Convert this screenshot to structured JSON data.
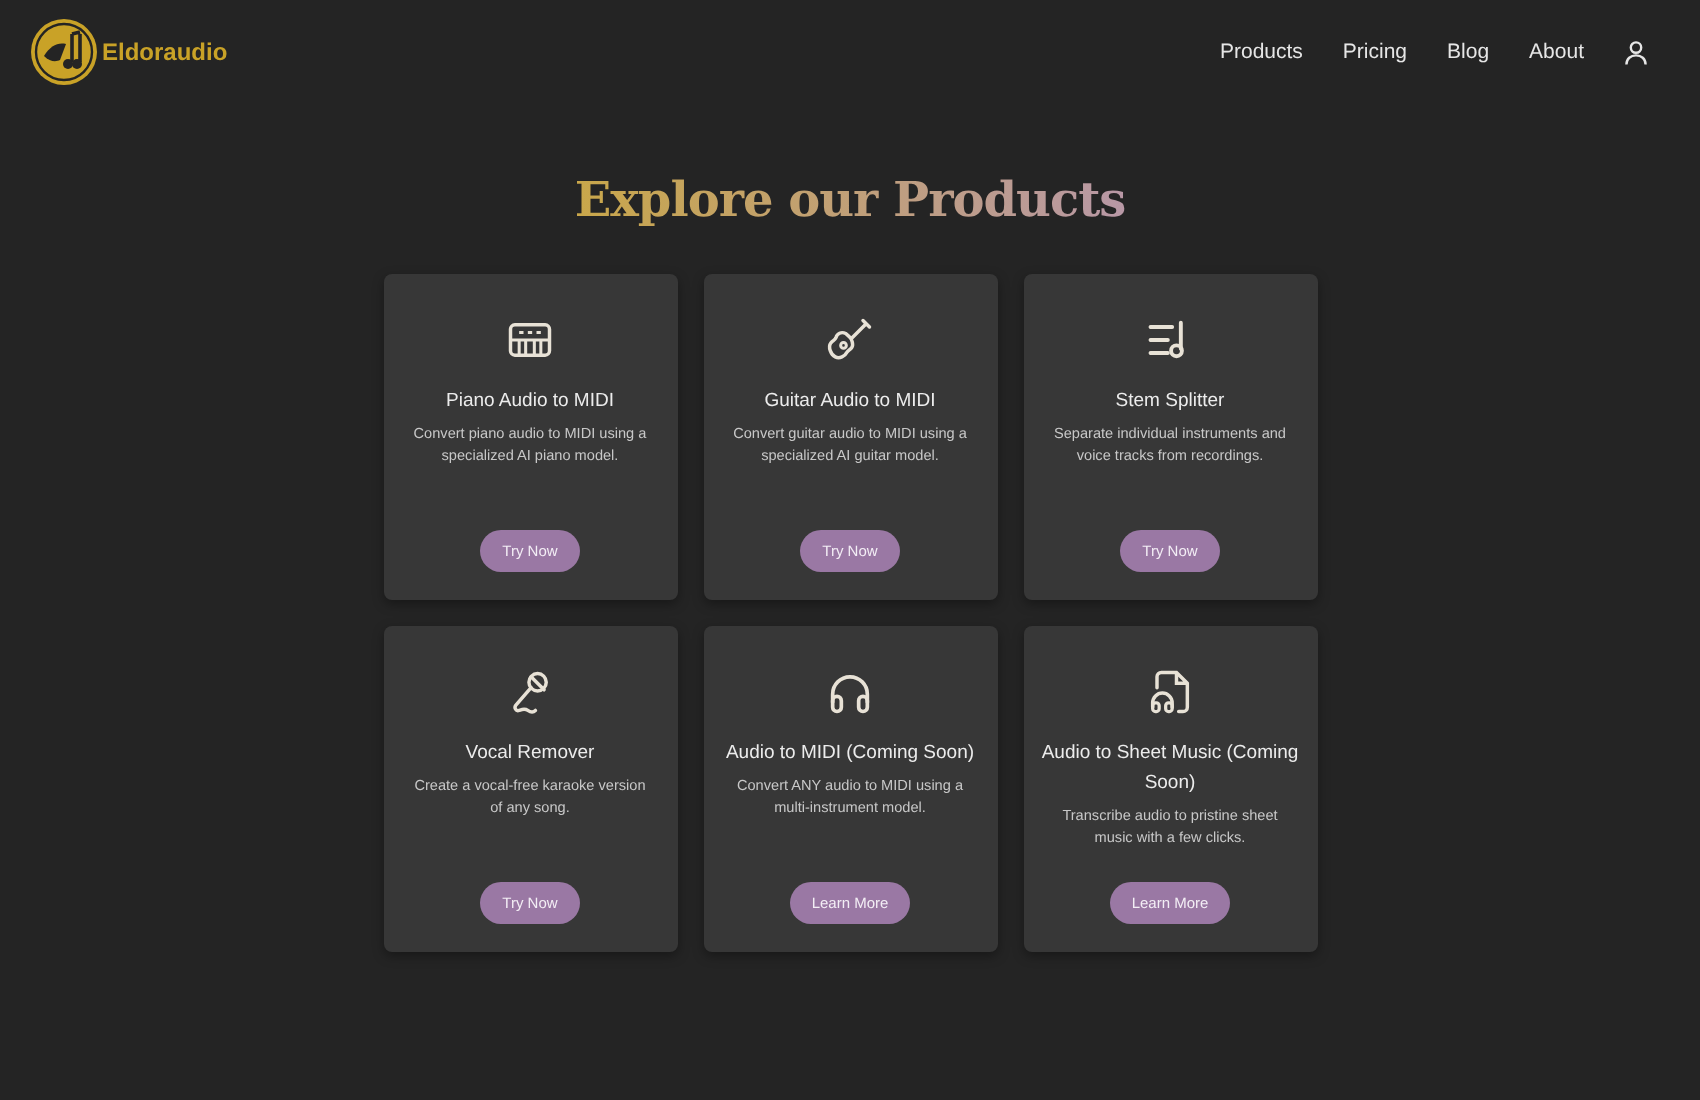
{
  "brand": {
    "name": "Eldoraudio"
  },
  "nav": [
    "Products",
    "Pricing",
    "Blog",
    "About"
  ],
  "heading": "Explore our Products",
  "products": [
    {
      "title": "Piano Audio to MIDI",
      "description": "Convert piano audio to MIDI using a specialized AI piano model.",
      "button": "Try Now"
    },
    {
      "title": "Guitar Audio to MIDI",
      "description": "Convert guitar audio to MIDI using a specialized AI guitar model.",
      "button": "Try Now"
    },
    {
      "title": "Stem Splitter",
      "description": "Separate individual instruments and voice tracks from recordings.",
      "button": "Try Now"
    },
    {
      "title": "Vocal Remover",
      "description": "Create a vocal-free karaoke version of any song.",
      "button": "Try Now"
    },
    {
      "title": "Audio to MIDI (Coming Soon)",
      "description": "Convert ANY audio to MIDI using a multi-instrument model.",
      "button": "Learn More"
    },
    {
      "title": "Audio to Sheet Music (Coming Soon)",
      "description": "Transcribe audio to pristine sheet music with a few clicks.",
      "button": "Learn More"
    }
  ]
}
